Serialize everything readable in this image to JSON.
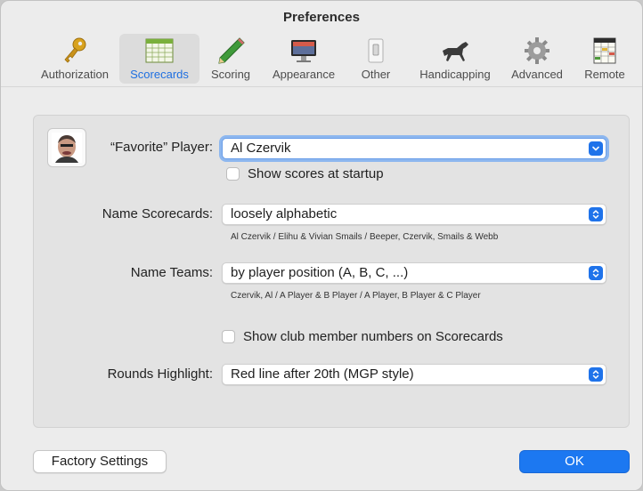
{
  "window": {
    "title": "Preferences"
  },
  "toolbar": {
    "items": [
      {
        "label": "Authorization"
      },
      {
        "label": "Scorecards",
        "selected": true
      },
      {
        "label": "Scoring"
      },
      {
        "label": "Appearance"
      },
      {
        "label": "Other"
      },
      {
        "label": "Handicapping"
      },
      {
        "label": "Advanced"
      },
      {
        "label": "Remote"
      }
    ]
  },
  "favorite_player": {
    "label": "“Favorite” Player:",
    "value": "Al Czervik",
    "show_scores_label": "Show scores at startup",
    "show_scores_checked": false
  },
  "name_scorecards": {
    "label": "Name Scorecards:",
    "value": "loosely alphabetic",
    "hint": "Al Czervik / Elihu & Vivian Smails / Beeper, Czervik, Smails & Webb"
  },
  "name_teams": {
    "label": "Name Teams:",
    "value": "by player position (A, B, C, ...)",
    "hint": "Czervik, Al / A Player & B Player / A Player, B Player & C Player"
  },
  "club_numbers": {
    "label": "Show club member numbers on Scorecards",
    "checked": false
  },
  "rounds_highlight": {
    "label": "Rounds Highlight:",
    "value": "Red line after 20th (MGP style)"
  },
  "buttons": {
    "factory_settings": "Factory Settings",
    "ok": "OK"
  },
  "colors": {
    "accent": "#1c78f1",
    "selected_tab_text": "#1f6fe0",
    "window_bg": "#ececec",
    "group_bg": "#e3e3e3"
  }
}
